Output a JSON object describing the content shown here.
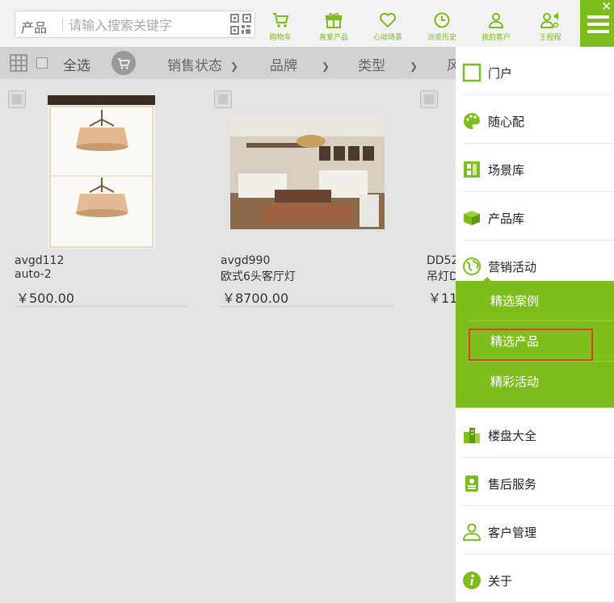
{
  "search": {
    "category": "产品",
    "placeholder": "请输入搜索关键字"
  },
  "toolbar": [
    {
      "label": "购物车",
      "icon": "cart-icon"
    },
    {
      "label": "喜爱产品",
      "icon": "gift-icon"
    },
    {
      "label": "心动场景",
      "icon": "heart-icon"
    },
    {
      "label": "浏览历史",
      "icon": "clock-icon"
    },
    {
      "label": "我的客户",
      "icon": "user-icon"
    },
    {
      "label": "王程程",
      "icon": "user-speaker-icon"
    }
  ],
  "filter": {
    "select_all": "全选",
    "dropdowns": [
      "销售状态",
      "品牌",
      "类型",
      "风"
    ]
  },
  "products": [
    {
      "code": "avgd112",
      "name": "auto-2",
      "price": "￥500.00"
    },
    {
      "code": "avgd990",
      "name": "欧式6头客厅灯",
      "price": "￥8700.00"
    },
    {
      "code": "DD52",
      "name": "吊灯D",
      "price": "￥11"
    }
  ],
  "menu": {
    "items": [
      {
        "label": "门户",
        "icon": "square-icon"
      },
      {
        "label": "随心配",
        "icon": "palette-icon"
      },
      {
        "label": "场景库",
        "icon": "scene-icon"
      },
      {
        "label": "产品库",
        "icon": "box-icon"
      },
      {
        "label": "营销活动",
        "icon": "globe-icon"
      },
      {
        "label": "楼盘大全",
        "icon": "buildings-icon"
      },
      {
        "label": "售后服务",
        "icon": "service-icon"
      },
      {
        "label": "客户管理",
        "icon": "person-icon"
      },
      {
        "label": "关于",
        "icon": "info-icon"
      }
    ],
    "sub_items": [
      {
        "label": "精选案例"
      },
      {
        "label": "精选产品"
      },
      {
        "label": "精彩活动"
      }
    ],
    "accent": "#7dbd1d",
    "highlight": "#e23c2b"
  }
}
